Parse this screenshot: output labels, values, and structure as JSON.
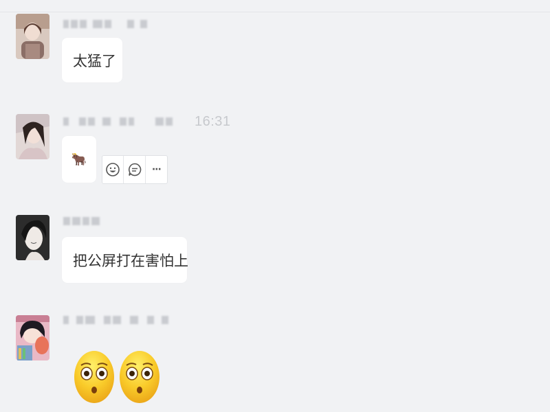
{
  "messages": [
    {
      "avatar_icon": "girl-portrait-avatar-icon",
      "sender_name_obscured": true,
      "content_type": "text",
      "text": "太猛了"
    },
    {
      "avatar_icon": "girl-portrait-avatar-icon",
      "sender_name_obscured": true,
      "time": "16:31",
      "content_type": "emoji",
      "emoji": "🐂",
      "actions": [
        {
          "name": "emoji-reaction-icon"
        },
        {
          "name": "reply-comment-icon"
        },
        {
          "name": "more-options-icon",
          "label": "···"
        }
      ]
    },
    {
      "avatar_icon": "sketch-boy-avatar-icon",
      "sender_name_obscured": true,
      "content_type": "text",
      "text": "把公屏打在害怕上"
    },
    {
      "avatar_icon": "cartoon-girl-avatar-icon",
      "sender_name_obscured": true,
      "content_type": "emoji",
      "emoji": "😳😳"
    }
  ],
  "colors": {
    "background": "#f1f2f4",
    "bubble": "#ffffff",
    "text": "#333333",
    "time": "#c7c9cd"
  }
}
